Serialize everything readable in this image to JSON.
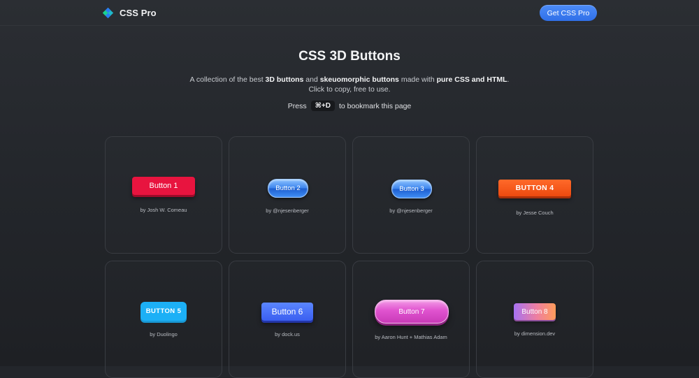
{
  "header": {
    "brand_name": "CSS Pro",
    "cta_label": "Get CSS Pro"
  },
  "hero": {
    "title": "CSS 3D Buttons",
    "sub_prefix": "A collection of the best ",
    "sub_bold1": "3D buttons",
    "sub_mid1": " and ",
    "sub_bold2": "skeuomorphic buttons",
    "sub_mid2": " made with ",
    "sub_bold3": "pure CSS and HTML",
    "sub_suffix": ".",
    "sub_line2": "Click to copy, free to use.",
    "bookmark_prefix": "Press",
    "bookmark_key": "⌘+D",
    "bookmark_suffix": "to bookmark this page"
  },
  "cards": [
    {
      "button_label": "Button 1",
      "credit": "by Josh W. Comeau"
    },
    {
      "button_label": "Button 2",
      "credit": "by @njesenberger"
    },
    {
      "button_label": "Button 3",
      "credit": "by @njesenberger"
    },
    {
      "button_label": "BUTTON 4",
      "credit": "by Jesse Couch"
    },
    {
      "button_label": "BUTTON 5",
      "credit": "by Duolingo"
    },
    {
      "button_label": "Button 6",
      "credit": "by dock.us"
    },
    {
      "button_label": "Button 7",
      "credit": "by Aaron Hunt + Mathias Adam"
    },
    {
      "button_label": "Button 8",
      "credit": "by dimension.dev"
    }
  ],
  "colors": {
    "background": "#23262b",
    "accent": "#3b7cf0"
  },
  "icons": {
    "logo": "css-pro-logo-icon"
  }
}
